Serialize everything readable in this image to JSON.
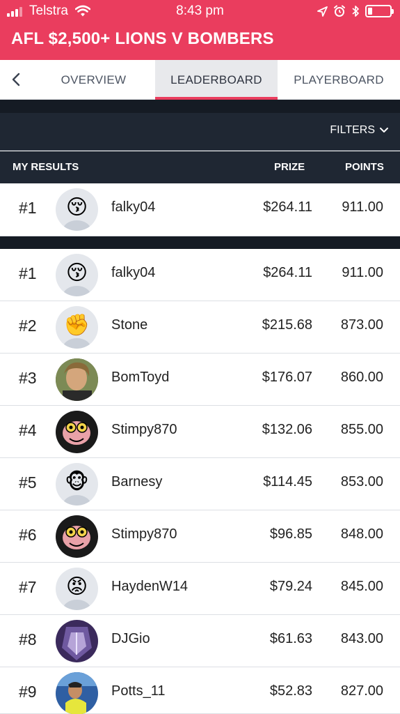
{
  "status": {
    "carrier": "Telstra",
    "time": "8:43 pm"
  },
  "header": {
    "title": "AFL $2,500+ LIONS V BOMBERS"
  },
  "tabs": [
    {
      "label": "OVERVIEW",
      "active": false
    },
    {
      "label": "LEADERBOARD",
      "active": true
    },
    {
      "label": "PLAYERBOARD",
      "active": false
    }
  ],
  "filters_label": "FILTERS",
  "columns": {
    "my_results": "MY RESULTS",
    "prize": "PRIZE",
    "points": "POINTS"
  },
  "my_result": {
    "rank": "#1",
    "name": "falky04",
    "prize": "$264.11",
    "points": "911.00",
    "avatar": "kissing-face"
  },
  "leaderboard": [
    {
      "rank": "#1",
      "name": "falky04",
      "prize": "$264.11",
      "points": "911.00",
      "avatar": "kissing-face"
    },
    {
      "rank": "#2",
      "name": "Stone",
      "prize": "$215.68",
      "points": "873.00",
      "avatar": "raised-fist"
    },
    {
      "rank": "#3",
      "name": "BomToyd",
      "prize": "$176.07",
      "points": "860.00",
      "avatar": "photo-person"
    },
    {
      "rank": "#4",
      "name": "Stimpy870",
      "prize": "$132.06",
      "points": "855.00",
      "avatar": "cartoon-cat"
    },
    {
      "rank": "#5",
      "name": "Barnesy",
      "prize": "$114.45",
      "points": "853.00",
      "avatar": "monkey-face"
    },
    {
      "rank": "#6",
      "name": "Stimpy870",
      "prize": "$96.85",
      "points": "848.00",
      "avatar": "cartoon-cat"
    },
    {
      "rank": "#7",
      "name": "HaydenW14",
      "prize": "$79.24",
      "points": "845.00",
      "avatar": "angry-face"
    },
    {
      "rank": "#8",
      "name": "DJGio",
      "prize": "$61.63",
      "points": "843.00",
      "avatar": "purple-abstract"
    },
    {
      "rank": "#9",
      "name": "Potts_11",
      "prize": "$52.83",
      "points": "827.00",
      "avatar": "photo-sports"
    }
  ],
  "colors": {
    "brand_red": "#ea3d5e",
    "dark_panel": "#1f2733",
    "dark_gap": "#151b24"
  }
}
